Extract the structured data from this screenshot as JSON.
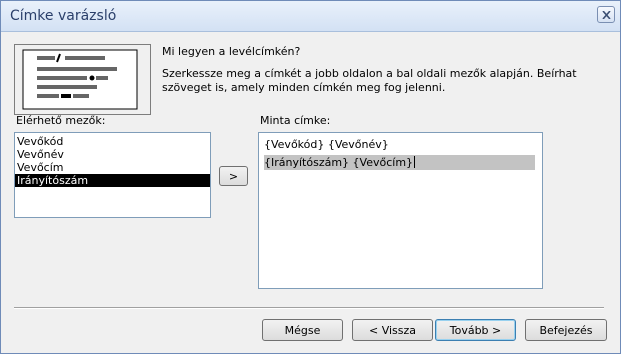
{
  "window": {
    "title": "Címke varázsló"
  },
  "header": {
    "question": "Mi legyen a levélcímkén?",
    "instruction": "Szerkessze meg a címkét a jobb oldalon a bal oldali mezők alapján. Beírhat szöveget is, amely minden címkén meg fog jelenni."
  },
  "available_fields": {
    "label": "Elérhető mezők:",
    "items": [
      "Vevőkód",
      "Vevőnév",
      "Vevőcím",
      "Irányítószám"
    ],
    "selected": "Irányítószám"
  },
  "add_button": {
    "label": ">"
  },
  "sample_label": {
    "label": "Minta címke:",
    "lines": [
      "{Vevőkód} {Vevőnév}",
      "{Irányítószám} {Vevőcím}"
    ]
  },
  "footer": {
    "cancel": "Mégse",
    "back": "< Vissza",
    "next": "Tovább >",
    "finish": "Befejezés"
  }
}
